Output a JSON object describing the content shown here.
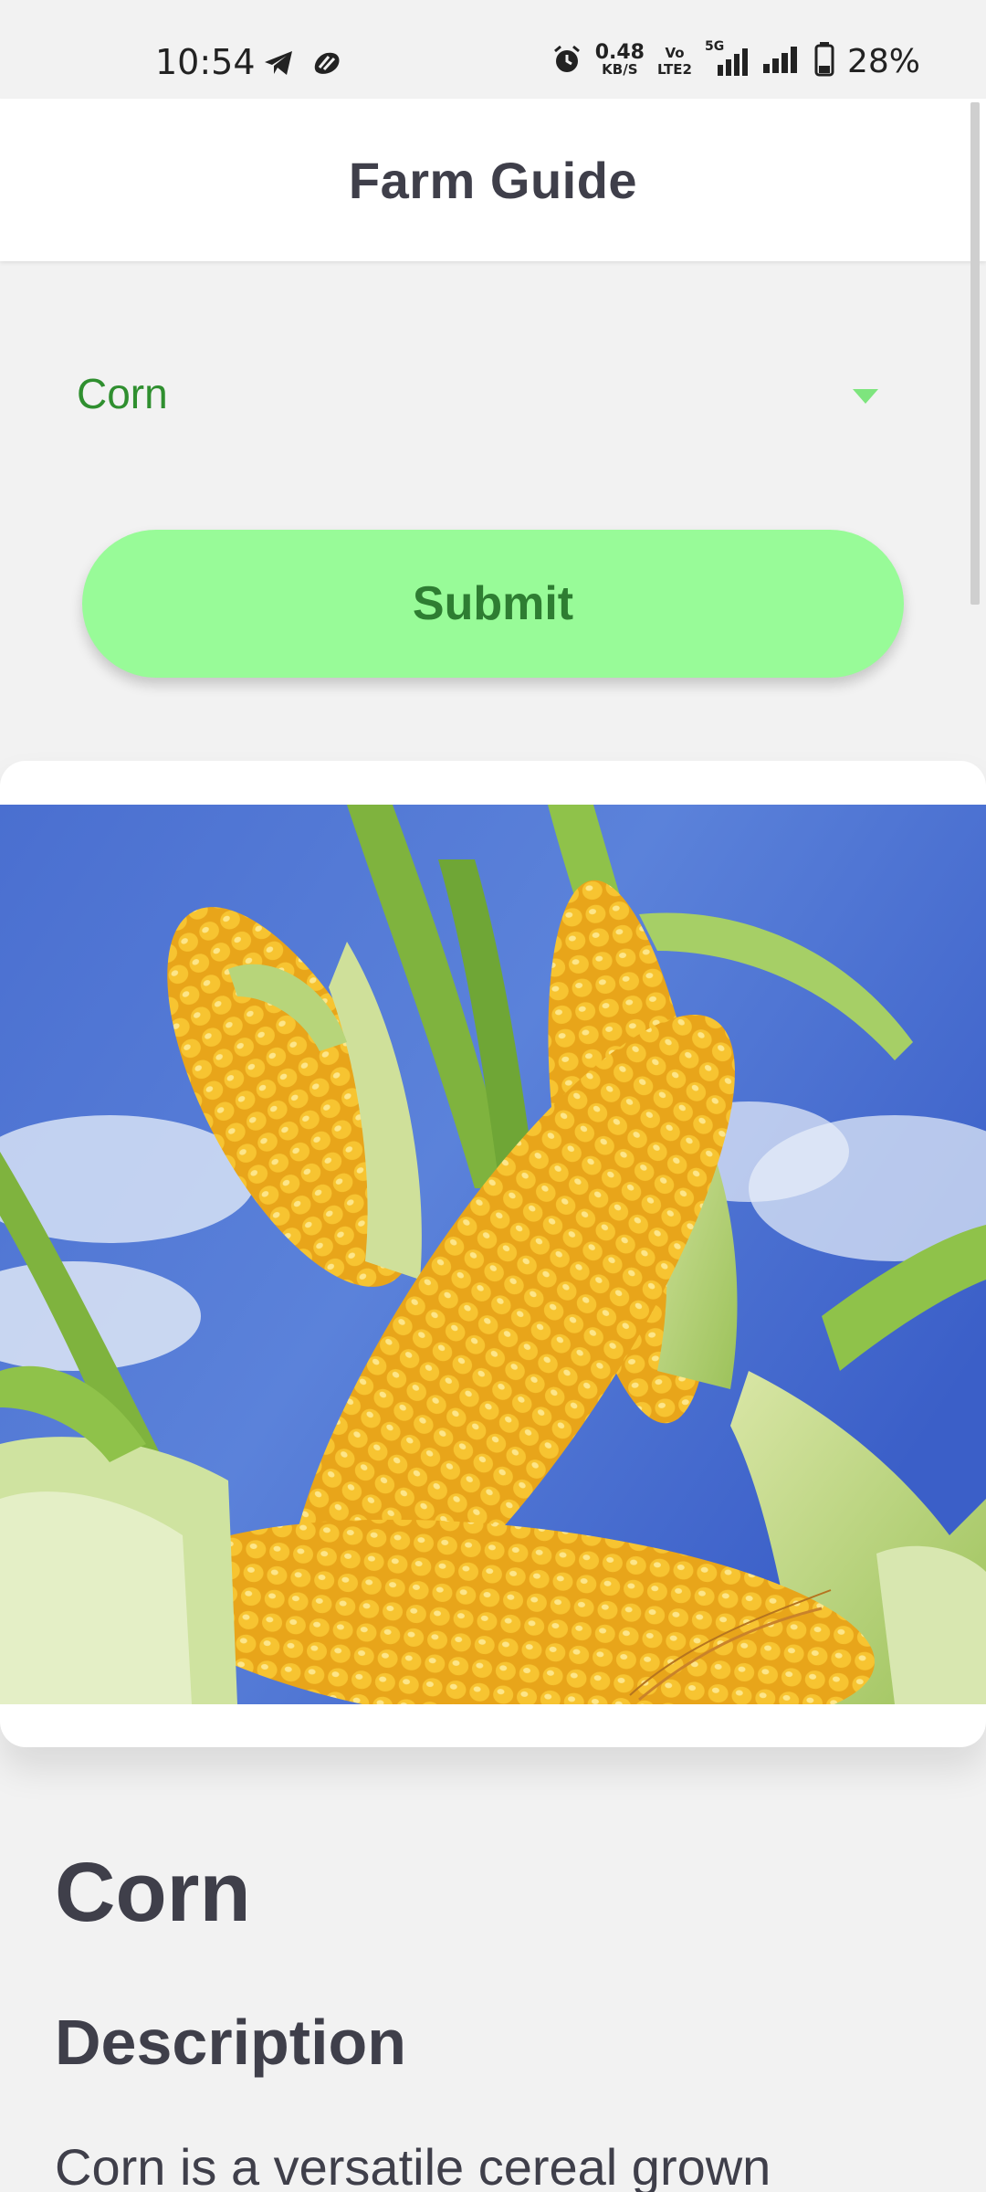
{
  "status_bar": {
    "time": "10:54",
    "net_speed_value": "0.48",
    "net_speed_unit": "KB/S",
    "volte_top": "Vo",
    "volte_bottom": "LTE2",
    "network_label": "5G",
    "battery_percent": "28%",
    "icons": [
      "telegram-icon",
      "app-notification-icon",
      "alarm-icon",
      "signal-icon",
      "signal-icon",
      "battery-icon"
    ]
  },
  "header": {
    "title": "Farm Guide"
  },
  "crop_selector": {
    "selected": "Corn",
    "accent_color": "#2f8f2f"
  },
  "submit": {
    "label": "Submit",
    "background_color": "#98fb98"
  },
  "crop": {
    "name": "Corn",
    "description_heading": "Description",
    "description": "Corn is a versatile cereal grown"
  }
}
